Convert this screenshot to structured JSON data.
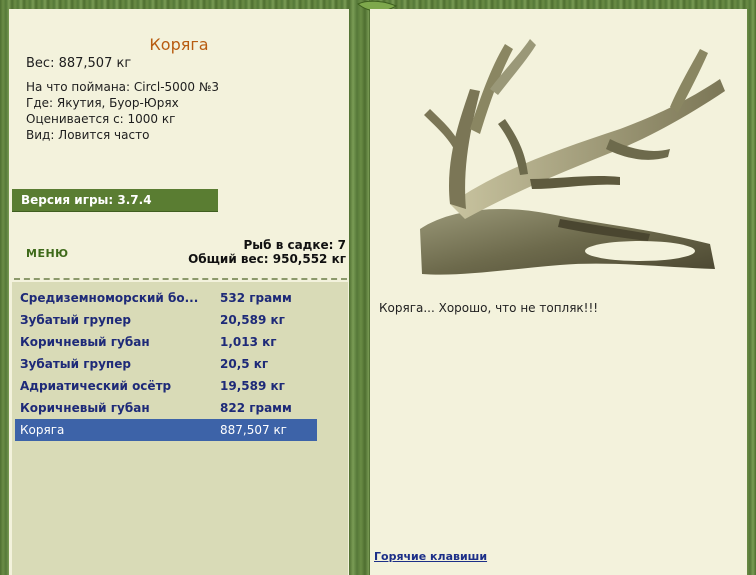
{
  "item": {
    "title": "Коряга",
    "weight": "Вес: 887,507 кг",
    "caught_on": "На что поймана: Circl-5000 №3",
    "location": "Где: Якутия, Буор-Юрях",
    "valued_from": "Оценивается с: 1000 кг",
    "frequency": "Вид: Ловится часто"
  },
  "version": "Версия игры: 3.7.4",
  "menu_label": "МЕНЮ",
  "keepnet": {
    "fish_count": "Рыб в садке: 7",
    "total_weight": "Общий вес: 950,552 кг"
  },
  "catch_list": [
    {
      "name": "Средиземноморский бо...",
      "weight": "532 грамм"
    },
    {
      "name": "Зубатый групер",
      "weight": "20,589 кг"
    },
    {
      "name": "Коричневый губан",
      "weight": "1,013 кг"
    },
    {
      "name": "Зубатый групер",
      "weight": "20,5 кг"
    },
    {
      "name": "Адриатический осётр",
      "weight": "19,589 кг"
    },
    {
      "name": "Коричневый губан",
      "weight": "822 грамм"
    },
    {
      "name": "Коряга",
      "weight": "887,507 кг"
    }
  ],
  "selected_index": 6,
  "message": "Коряга... Хорошо, что не топляк!!!",
  "hotkeys_link": "Горячие клавиши",
  "colors": {
    "frame_green": "#5a7a3a",
    "panel_bg": "#f3f2dc",
    "title_orange": "#b85c10",
    "selection_blue": "#3d63a8",
    "list_text": "#1e2a78"
  }
}
